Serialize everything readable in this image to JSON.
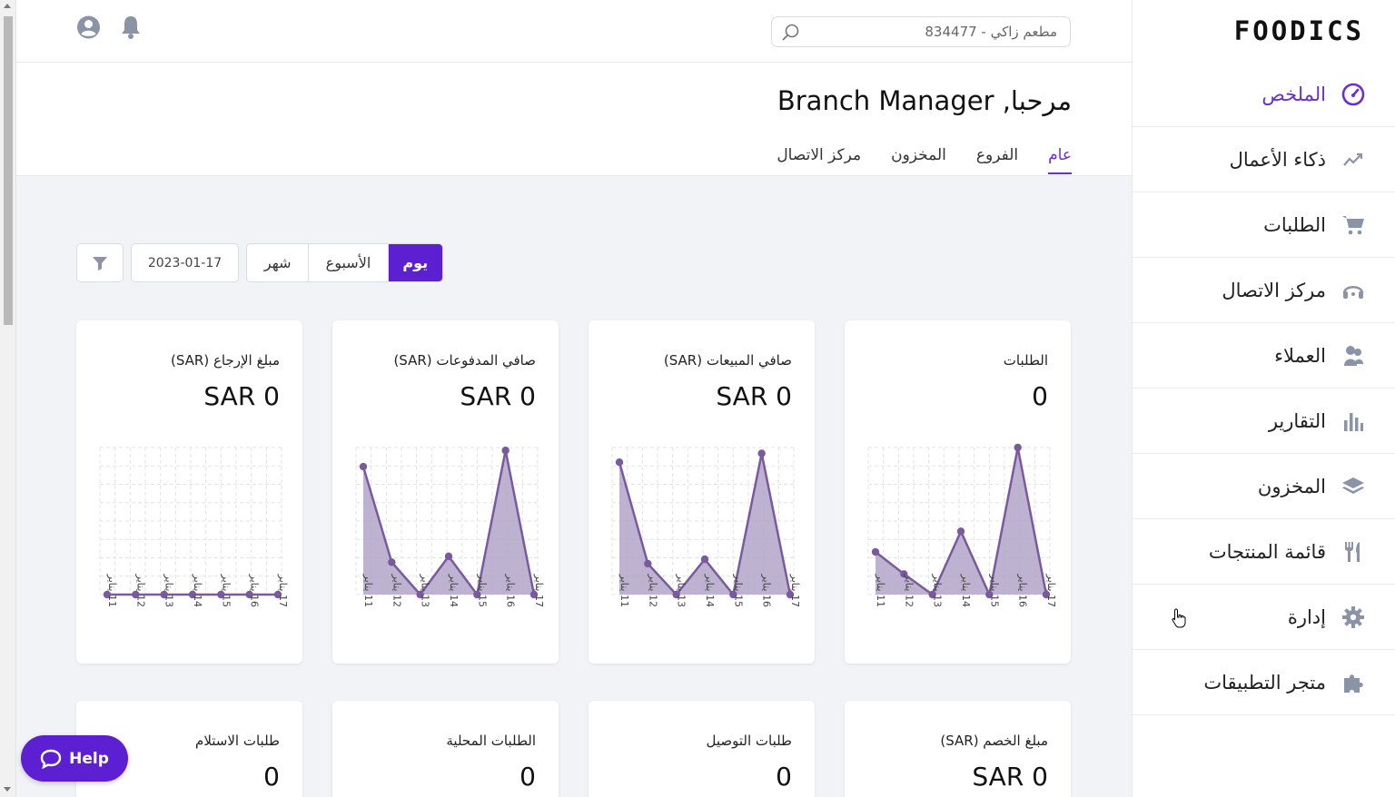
{
  "brand": {
    "logo_text": "FOODICS",
    "accent": "#5c1fd1"
  },
  "topbar": {
    "search_value": "مطعم زاكي - 834477"
  },
  "sidebar": {
    "items": [
      {
        "label": "الملخص",
        "icon": "gauge-icon",
        "active": true
      },
      {
        "label": "ذكاء الأعمال",
        "icon": "trend-icon"
      },
      {
        "label": "الطلبات",
        "icon": "cart-icon"
      },
      {
        "label": "مركز الاتصال",
        "icon": "headset-icon"
      },
      {
        "label": "العملاء",
        "icon": "users-icon"
      },
      {
        "label": "التقارير",
        "icon": "bar-chart-icon"
      },
      {
        "label": "المخزون",
        "icon": "layers-icon"
      },
      {
        "label": "قائمة المنتجات",
        "icon": "utensils-icon"
      },
      {
        "label": "إدارة",
        "icon": "gear-icon"
      },
      {
        "label": "متجر التطبيقات",
        "icon": "puzzle-icon"
      }
    ]
  },
  "header": {
    "greeting": "مرحبا, Branch Manager",
    "tabs": [
      {
        "label": "عام",
        "active": true
      },
      {
        "label": "الفروع"
      },
      {
        "label": "المخزون"
      },
      {
        "label": "مركز الاتصال"
      }
    ]
  },
  "filters": {
    "day": "يوم",
    "week": "الأسبوع",
    "month": "شهر",
    "date": "2023-01-17"
  },
  "x_labels": [
    "11 يناير",
    "12 يناير",
    "13 يناير",
    "14 يناير",
    "15 يناير",
    "16 يناير",
    "17 يناير"
  ],
  "cards": [
    {
      "title": "الطلبات",
      "value": "0"
    },
    {
      "title": "صافي المبيعات (SAR)",
      "value": "SAR 0"
    },
    {
      "title": "صافي المدفوعات (SAR)",
      "value": "SAR 0"
    },
    {
      "title": "مبلغ الإرجاع (SAR)",
      "value": "SAR 0"
    },
    {
      "title": "مبلغ الخصم (SAR)",
      "value": "SAR 0"
    },
    {
      "title": "طلبات التوصيل",
      "value": "0"
    },
    {
      "title": "الطلبات المحلية",
      "value": "0"
    },
    {
      "title": "طلبات الاستلام",
      "value": "0"
    }
  ],
  "chart_data": [
    {
      "type": "area",
      "x": [
        "11 يناير",
        "12 يناير",
        "13 يناير",
        "14 يناير",
        "15 يناير",
        "16 يناير",
        "17 يناير"
      ],
      "values": [
        0.29,
        0.14,
        0,
        0.43,
        0,
        1.0,
        0
      ],
      "ylim": [
        0,
        1
      ]
    },
    {
      "type": "area",
      "x": [
        "11 يناير",
        "12 يناير",
        "13 يناير",
        "14 يناير",
        "15 يناير",
        "16 يناير",
        "17 يناير"
      ],
      "values": [
        0.9,
        0.21,
        0,
        0.24,
        0,
        0.96,
        0
      ],
      "ylim": [
        0,
        1
      ]
    },
    {
      "type": "area",
      "x": [
        "11 يناير",
        "12 يناير",
        "13 يناير",
        "14 يناير",
        "15 يناير",
        "16 يناير",
        "17 يناير"
      ],
      "values": [
        0.87,
        0.22,
        0,
        0.26,
        0,
        0.98,
        0
      ],
      "ylim": [
        0,
        1
      ]
    },
    {
      "type": "area",
      "x": [
        "11 يناير",
        "12 يناير",
        "13 يناير",
        "14 يناير",
        "15 يناير",
        "16 يناير",
        "17 يناير"
      ],
      "values": [
        0,
        0,
        0,
        0,
        0,
        0,
        0
      ],
      "ylim": [
        0,
        1
      ]
    }
  ],
  "help": {
    "label": "Help"
  }
}
